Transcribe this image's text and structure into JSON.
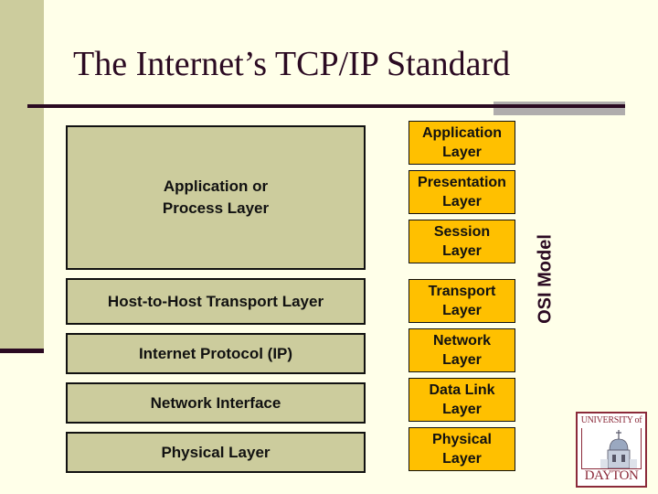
{
  "slide": {
    "title": "The Internet’s TCP/IP Standard"
  },
  "tcpip_layers": [
    {
      "label": "Application or\nProcess Layer"
    },
    {
      "label": "Host-to-Host Transport  Layer"
    },
    {
      "label": "Internet Protocol (IP)"
    },
    {
      "label": "Network Interface"
    },
    {
      "label": "Physical Layer"
    }
  ],
  "osi_layers": [
    {
      "label": "Application\nLayer"
    },
    {
      "label": "Presentation\nLayer"
    },
    {
      "label": "Session\nLayer"
    },
    {
      "label": "Transport\nLayer"
    },
    {
      "label": "Network\nLayer"
    },
    {
      "label": "Data Link\nLayer"
    },
    {
      "label": "Physical\nLayer"
    }
  ],
  "osi_label": "OSI Model",
  "logo": {
    "top_text": "UNIVERSITY of",
    "bottom_text": "DAYTON"
  },
  "colors": {
    "tcpip_box": "#cccc9d",
    "osi_box": "#ffc000",
    "accent": "#2b0a22",
    "logo": "#8b2a3a"
  }
}
